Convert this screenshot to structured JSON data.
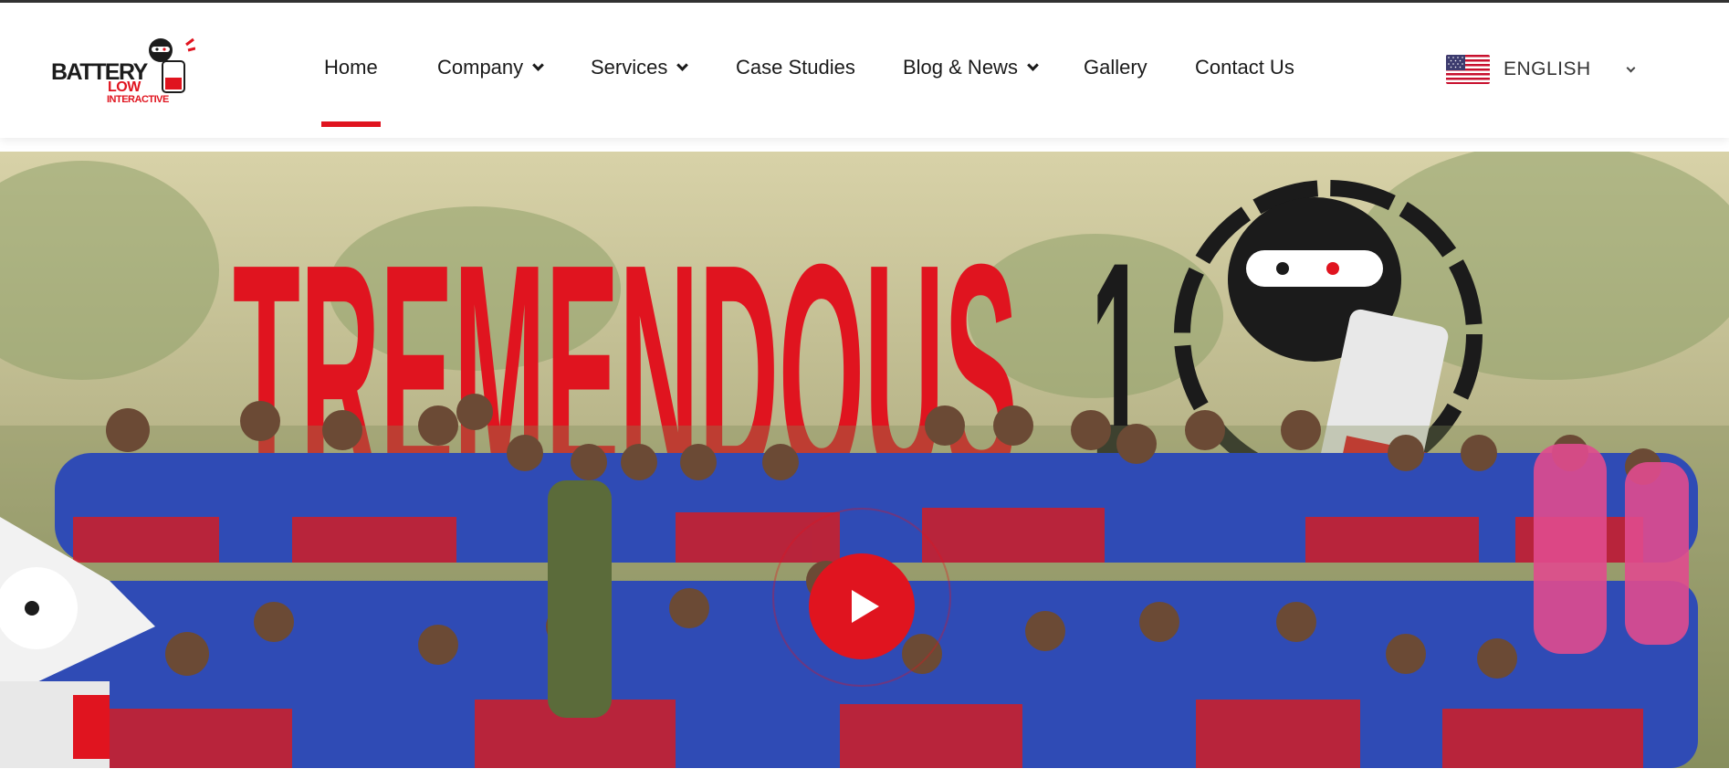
{
  "brand": {
    "word1": "BATTERY",
    "word2": "LOW",
    "word3": "INTERACTIVE",
    "accent_color": "#e0141f"
  },
  "nav": {
    "items": [
      {
        "label": "Home",
        "active": true,
        "has_dropdown": false
      },
      {
        "label": "Company",
        "active": false,
        "has_dropdown": true
      },
      {
        "label": "Services",
        "active": false,
        "has_dropdown": true
      },
      {
        "label": "Case Studies",
        "active": false,
        "has_dropdown": false
      },
      {
        "label": "Blog & News",
        "active": false,
        "has_dropdown": true
      },
      {
        "label": "Gallery",
        "active": false,
        "has_dropdown": false
      },
      {
        "label": "Contact Us",
        "active": false,
        "has_dropdown": false
      }
    ]
  },
  "language": {
    "label": "ENGLISH",
    "flag_icon": "us-flag-icon"
  },
  "hero": {
    "banner_text": "TREMENDOUS",
    "banner_number": "1",
    "play_icon": "play-icon"
  }
}
